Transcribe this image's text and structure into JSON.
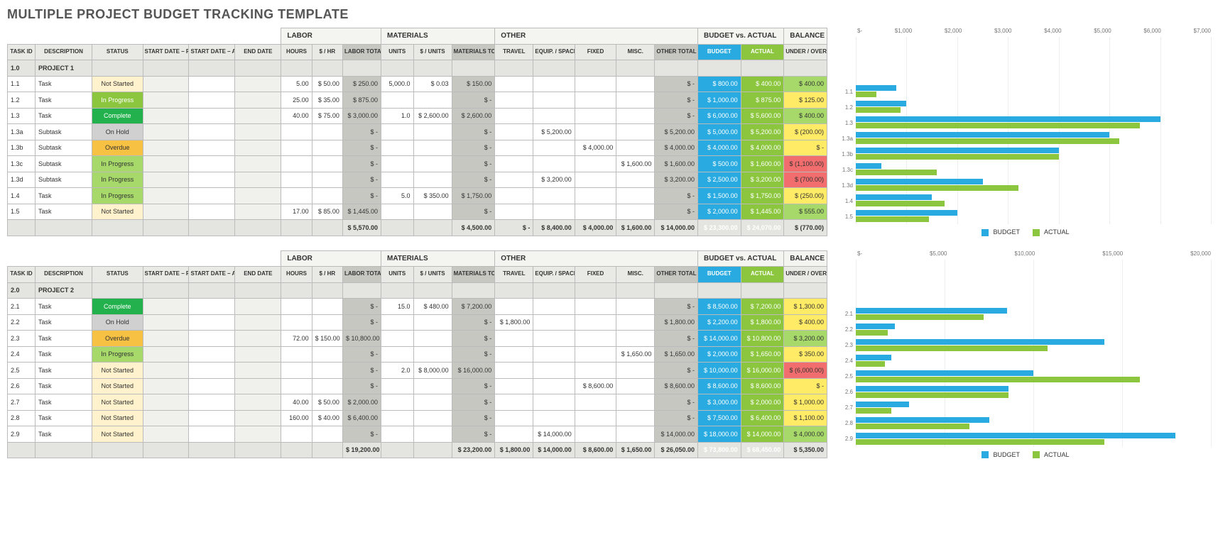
{
  "title": "MULTIPLE PROJECT BUDGET TRACKING TEMPLATE",
  "group_headers": {
    "labor": "LABOR",
    "materials": "MATERIALS",
    "other": "OTHER",
    "bva": "BUDGET vs. ACTUAL",
    "balance": "BALANCE"
  },
  "cols": {
    "task_id": "TASK ID",
    "desc": "DESCRIPTION",
    "status": "STATUS",
    "sd_plan": "START DATE – PLANNED –",
    "sd_act": "START DATE – ACTUAL –",
    "end": "END DATE",
    "hours": "HOURS",
    "rate": "$ / HR",
    "labor_tot": "LABOR TOTAL",
    "units": "UNITS",
    "unit_cost": "$ / UNITS",
    "mat_tot": "MATERIALS TOTAL",
    "travel": "TRAVEL",
    "equip": "EQUIP. / SPACE",
    "fixed": "FIXED",
    "misc": "MISC.",
    "other_tot": "OTHER TOTAL",
    "budget": "BUDGET",
    "actual": "ACTUAL",
    "under_over": "UNDER / OVER"
  },
  "legend": {
    "budget": "BUDGET",
    "actual": "ACTUAL"
  },
  "status_labels": {
    "ns": "Not Started",
    "ip": "In Progress",
    "co": "Complete",
    "oh": "On Hold",
    "ov": "Overdue"
  },
  "projects": [
    {
      "id": "1.0",
      "name": "PROJECT 1",
      "axis": [
        "$-",
        "$1,000",
        "$2,000",
        "$3,000",
        "$4,000",
        "$5,000",
        "$6,000",
        "$7,000"
      ],
      "axis_max": 7000,
      "rows": [
        {
          "id": "1.1",
          "desc": "Task",
          "st": "ns",
          "hours": "5.00",
          "rate": "50.00",
          "labor": "250.00",
          "units": "5,000.0",
          "unitcost": "0.03",
          "mat": "150.00",
          "other": "-",
          "budget": "800.00",
          "actual": "400.00",
          "bal": "400.00",
          "balcls": "g",
          "b": 800,
          "a": 400
        },
        {
          "id": "1.2",
          "desc": "Task",
          "st": "ip",
          "hours": "25.00",
          "rate": "35.00",
          "labor": "875.00",
          "mat": "-",
          "other": "-",
          "budget": "1,000.00",
          "actual": "875.00",
          "bal": "125.00",
          "balcls": "y",
          "b": 1000,
          "a": 875
        },
        {
          "id": "1.3",
          "desc": "Task",
          "st": "co",
          "hours": "40.00",
          "rate": "75.00",
          "labor": "3,000.00",
          "units": "1.0",
          "unitcost": "2,600.00",
          "mat": "2,600.00",
          "other": "-",
          "budget": "6,000.00",
          "actual": "5,600.00",
          "bal": "400.00",
          "balcls": "g",
          "b": 6000,
          "a": 5600
        },
        {
          "id": "1.3a",
          "desc": "Subtask",
          "st": "oh",
          "labor": "-",
          "mat": "-",
          "equip": "5,200.00",
          "other": "5,200.00",
          "budget": "5,000.00",
          "actual": "5,200.00",
          "bal": "(200.00)",
          "balcls": "y",
          "b": 5000,
          "a": 5200
        },
        {
          "id": "1.3b",
          "desc": "Subtask",
          "st": "ov",
          "labor": "-",
          "mat": "-",
          "fixed": "4,000.00",
          "other": "4,000.00",
          "budget": "4,000.00",
          "actual": "4,000.00",
          "bal": "-",
          "balcls": "y",
          "b": 4000,
          "a": 4000
        },
        {
          "id": "1.3c",
          "desc": "Subtask",
          "st": "ip",
          "labor": "-",
          "mat": "-",
          "misc": "1,600.00",
          "other": "1,600.00",
          "budget": "500.00",
          "actual": "1,600.00",
          "bal": "(1,100.00)",
          "balcls": "r",
          "b": 500,
          "a": 1600
        },
        {
          "id": "1.3d",
          "desc": "Subtask",
          "st": "ip",
          "labor": "-",
          "mat": "-",
          "equip": "3,200.00",
          "other": "3,200.00",
          "budget": "2,500.00",
          "actual": "3,200.00",
          "bal": "(700.00)",
          "balcls": "r",
          "b": 2500,
          "a": 3200
        },
        {
          "id": "1.4",
          "desc": "Task",
          "st": "ip",
          "labor": "-",
          "units": "5.0",
          "unitcost": "350.00",
          "mat": "1,750.00",
          "other": "-",
          "budget": "1,500.00",
          "actual": "1,750.00",
          "bal": "(250.00)",
          "balcls": "y",
          "b": 1500,
          "a": 1750
        },
        {
          "id": "1.5",
          "desc": "Task",
          "st": "ns",
          "hours": "17.00",
          "rate": "85.00",
          "labor": "1,445.00",
          "mat": "-",
          "other": "-",
          "budget": "2,000.00",
          "actual": "1,445.00",
          "bal": "555.00",
          "balcls": "g",
          "b": 2000,
          "a": 1445
        }
      ],
      "totals": {
        "labor": "5,570.00",
        "mat": "4,500.00",
        "travel": "-",
        "equip": "8,400.00",
        "fixed": "4,000.00",
        "misc": "1,600.00",
        "other": "14,000.00",
        "budget": "23,300.00",
        "actual": "24,070.00",
        "bal": "(770.00)",
        "balcls": "r"
      }
    },
    {
      "id": "2.0",
      "name": "PROJECT 2",
      "axis": [
        "$-",
        "$5,000",
        "$10,000",
        "$15,000",
        "$20,000"
      ],
      "axis_max": 20000,
      "rows": [
        {
          "id": "2.1",
          "desc": "Task",
          "st": "co",
          "labor": "-",
          "units": "15.0",
          "unitcost": "480.00",
          "mat": "7,200.00",
          "other": "-",
          "budget": "8,500.00",
          "actual": "7,200.00",
          "bal": "1,300.00",
          "balcls": "y",
          "b": 8500,
          "a": 7200
        },
        {
          "id": "2.2",
          "desc": "Task",
          "st": "oh",
          "labor": "-",
          "mat": "-",
          "travel": "1,800.00",
          "other": "1,800.00",
          "budget": "2,200.00",
          "actual": "1,800.00",
          "bal": "400.00",
          "balcls": "y",
          "b": 2200,
          "a": 1800
        },
        {
          "id": "2.3",
          "desc": "Task",
          "st": "ov",
          "hours": "72.00",
          "rate": "150.00",
          "labor": "10,800.00",
          "mat": "-",
          "other": "-",
          "budget": "14,000.00",
          "actual": "10,800.00",
          "bal": "3,200.00",
          "balcls": "g",
          "b": 14000,
          "a": 10800
        },
        {
          "id": "2.4",
          "desc": "Task",
          "st": "ip",
          "labor": "-",
          "mat": "-",
          "misc": "1,650.00",
          "other": "1,650.00",
          "budget": "2,000.00",
          "actual": "1,650.00",
          "bal": "350.00",
          "balcls": "y",
          "b": 2000,
          "a": 1650
        },
        {
          "id": "2.5",
          "desc": "Task",
          "st": "ns",
          "labor": "-",
          "units": "2.0",
          "unitcost": "8,000.00",
          "mat": "16,000.00",
          "other": "-",
          "budget": "10,000.00",
          "actual": "16,000.00",
          "bal": "(6,000.00)",
          "balcls": "r",
          "b": 10000,
          "a": 16000
        },
        {
          "id": "2.6",
          "desc": "Task",
          "st": "ns",
          "labor": "-",
          "mat": "-",
          "fixed": "8,600.00",
          "other": "8,600.00",
          "budget": "8,600.00",
          "actual": "8,600.00",
          "bal": "-",
          "balcls": "y",
          "b": 8600,
          "a": 8600
        },
        {
          "id": "2.7",
          "desc": "Task",
          "st": "ns",
          "hours": "40.00",
          "rate": "50.00",
          "labor": "2,000.00",
          "mat": "-",
          "other": "-",
          "budget": "3,000.00",
          "actual": "2,000.00",
          "bal": "1,000.00",
          "balcls": "y",
          "b": 3000,
          "a": 2000
        },
        {
          "id": "2.8",
          "desc": "Task",
          "st": "ns",
          "hours": "160.00",
          "rate": "40.00",
          "labor": "6,400.00",
          "mat": "-",
          "other": "-",
          "budget": "7,500.00",
          "actual": "6,400.00",
          "bal": "1,100.00",
          "balcls": "y",
          "b": 7500,
          "a": 6400
        },
        {
          "id": "2.9",
          "desc": "Task",
          "st": "ns",
          "labor": "-",
          "mat": "-",
          "equip": "14,000.00",
          "other": "14,000.00",
          "budget": "18,000.00",
          "actual": "14,000.00",
          "bal": "4,000.00",
          "balcls": "g",
          "b": 18000,
          "a": 14000
        }
      ],
      "totals": {
        "labor": "19,200.00",
        "mat": "23,200.00",
        "travel": "1,800.00",
        "equip": "14,000.00",
        "fixed": "8,600.00",
        "misc": "1,650.00",
        "other": "26,050.00",
        "budget": "73,800.00",
        "actual": "68,450.00",
        "bal": "5,350.00",
        "balcls": "g"
      }
    }
  ],
  "chart_data": [
    {
      "type": "bar",
      "title": "",
      "xlabel": "",
      "ylabel": "",
      "orientation": "horizontal",
      "categories": [
        "1.1",
        "1.2",
        "1.3",
        "1.3a",
        "1.3b",
        "1.3c",
        "1.3d",
        "1.4",
        "1.5"
      ],
      "xlim": [
        0,
        7000
      ],
      "x_ticklabels": [
        "$-",
        "$1,000",
        "$2,000",
        "$3,000",
        "$4,000",
        "$5,000",
        "$6,000",
        "$7,000"
      ],
      "series": [
        {
          "name": "BUDGET",
          "values": [
            800,
            1000,
            6000,
            5000,
            4000,
            500,
            2500,
            1500,
            2000
          ]
        },
        {
          "name": "ACTUAL",
          "values": [
            400,
            875,
            5600,
            5200,
            4000,
            1600,
            3200,
            1750,
            1445
          ]
        }
      ]
    },
    {
      "type": "bar",
      "title": "",
      "xlabel": "",
      "ylabel": "",
      "orientation": "horizontal",
      "categories": [
        "2.1",
        "2.2",
        "2.3",
        "2.4",
        "2.5",
        "2.6",
        "2.7",
        "2.8",
        "2.9"
      ],
      "xlim": [
        0,
        20000
      ],
      "x_ticklabels": [
        "$-",
        "$5,000",
        "$10,000",
        "$15,000",
        "$20,000"
      ],
      "series": [
        {
          "name": "BUDGET",
          "values": [
            8500,
            2200,
            14000,
            2000,
            10000,
            8600,
            3000,
            7500,
            18000
          ]
        },
        {
          "name": "ACTUAL",
          "values": [
            7200,
            1800,
            10800,
            1650,
            16000,
            8600,
            2000,
            6400,
            14000
          ]
        }
      ]
    }
  ]
}
